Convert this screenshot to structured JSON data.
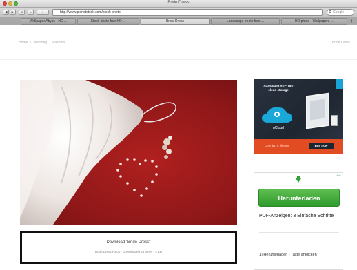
{
  "window": {
    "title": "Bride Dress",
    "url": "http://www.planetstock.com/stock-photo",
    "search_placeholder": "Google"
  },
  "tabs": [
    {
      "label": "Wallpaper Abyss - HD ..."
    },
    {
      "label": "Stock photo free HD ..."
    },
    {
      "label": "Bride Dress"
    },
    {
      "label": "Landscape photo free ..."
    },
    {
      "label": "HD photo - Wallpapers ..."
    }
  ],
  "breadcrumb": {
    "items": [
      "Home",
      "/",
      "Wedding",
      "/",
      "Fashion"
    ],
    "right": "Bride Dress"
  },
  "download": {
    "title": "Download \"Bride Dress\"",
    "subtitle": "Bride Dress Fotos - Downloaded 23 times - 4 KB"
  },
  "ad1": {
    "headline": "Get 500GB SECURE cloud storage",
    "brand": "pCloud",
    "footer_text": "Only $175 lifetime",
    "cta": "Buy now"
  },
  "ad2": {
    "corner": "Ads",
    "button": "Herunterladen",
    "title": "PDF-Anzeigen: 3 Einfache Schritte",
    "step1": "1) Herunterladen - Taste anklicken"
  },
  "colors": {
    "ad_green": "#33a33a",
    "ad1_orange": "#e24c22",
    "ad1_cloud": "#1aa8d8",
    "photo_red": "#9b1b1c"
  }
}
